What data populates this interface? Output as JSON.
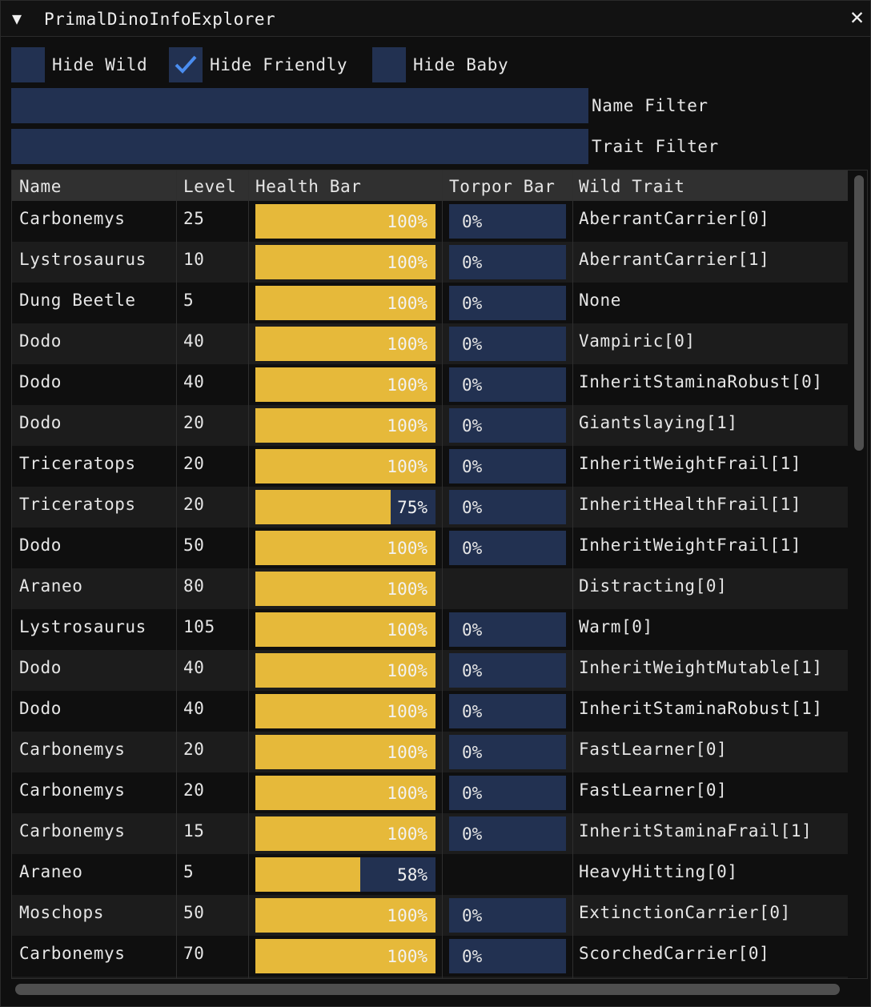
{
  "window": {
    "title": "PrimalDinoInfoExplorer",
    "collapse_glyph": "▼",
    "close_glyph": "✕"
  },
  "checkboxes": [
    {
      "label": "Hide Wild",
      "checked": false
    },
    {
      "label": "Hide Friendly",
      "checked": true
    },
    {
      "label": "Hide Baby",
      "checked": false
    }
  ],
  "filters": {
    "name_label": "Name Filter",
    "name_value": "",
    "trait_label": "Trait Filter",
    "trait_value": ""
  },
  "table": {
    "columns": [
      "Name",
      "Level",
      "Health Bar",
      "Torpor Bar",
      "Wild Trait"
    ],
    "rows": [
      {
        "name": "Carbonemys",
        "level": "25",
        "health": "100%",
        "health_frac": 1.0,
        "torpor": "0%",
        "trait": "AberrantCarrier[0]"
      },
      {
        "name": "Lystrosaurus",
        "level": "10",
        "health": "100%",
        "health_frac": 1.0,
        "torpor": "0%",
        "trait": "AberrantCarrier[1]"
      },
      {
        "name": "Dung Beetle",
        "level": "5",
        "health": "100%",
        "health_frac": 1.0,
        "torpor": "0%",
        "trait": "None"
      },
      {
        "name": "Dodo",
        "level": "40",
        "health": "100%",
        "health_frac": 1.0,
        "torpor": "0%",
        "trait": "Vampiric[0]"
      },
      {
        "name": "Dodo",
        "level": "40",
        "health": "100%",
        "health_frac": 1.0,
        "torpor": "0%",
        "trait": "InheritStaminaRobust[0]"
      },
      {
        "name": "Dodo",
        "level": "20",
        "health": "100%",
        "health_frac": 1.0,
        "torpor": "0%",
        "trait": "Giantslaying[1]"
      },
      {
        "name": "Triceratops",
        "level": "20",
        "health": "100%",
        "health_frac": 1.0,
        "torpor": "0%",
        "trait": "InheritWeightFrail[1]"
      },
      {
        "name": "Triceratops",
        "level": "20",
        "health": "75%",
        "health_frac": 0.75,
        "torpor": "0%",
        "trait": "InheritHealthFrail[1]"
      },
      {
        "name": "Dodo",
        "level": "50",
        "health": "100%",
        "health_frac": 1.0,
        "torpor": "0%",
        "trait": "InheritWeightFrail[1]"
      },
      {
        "name": "Araneo",
        "level": "80",
        "health": "100%",
        "health_frac": 1.0,
        "torpor": null,
        "trait": "Distracting[0]"
      },
      {
        "name": "Lystrosaurus",
        "level": "105",
        "health": "100%",
        "health_frac": 1.0,
        "torpor": "0%",
        "trait": "Warm[0]"
      },
      {
        "name": "Dodo",
        "level": "40",
        "health": "100%",
        "health_frac": 1.0,
        "torpor": "0%",
        "trait": "InheritWeightMutable[1]"
      },
      {
        "name": "Dodo",
        "level": "40",
        "health": "100%",
        "health_frac": 1.0,
        "torpor": "0%",
        "trait": "InheritStaminaRobust[1]"
      },
      {
        "name": "Carbonemys",
        "level": "20",
        "health": "100%",
        "health_frac": 1.0,
        "torpor": "0%",
        "trait": "FastLearner[0]"
      },
      {
        "name": "Carbonemys",
        "level": "20",
        "health": "100%",
        "health_frac": 1.0,
        "torpor": "0%",
        "trait": "FastLearner[0]"
      },
      {
        "name": "Carbonemys",
        "level": "15",
        "health": "100%",
        "health_frac": 1.0,
        "torpor": "0%",
        "trait": "InheritStaminaFrail[1]"
      },
      {
        "name": "Araneo",
        "level": "5",
        "health": "58%",
        "health_frac": 0.58,
        "torpor": null,
        "trait": "HeavyHitting[0]"
      },
      {
        "name": "Moschops",
        "level": "50",
        "health": "100%",
        "health_frac": 1.0,
        "torpor": "0%",
        "trait": "ExtinctionCarrier[0]"
      },
      {
        "name": "Carbonemys",
        "level": "70",
        "health": "100%",
        "health_frac": 1.0,
        "torpor": "0%",
        "trait": "ScorchedCarrier[0]"
      }
    ]
  },
  "colors": {
    "health_fill": "#e6b93a",
    "bar_bg": "#223151",
    "checkmark": "#4a8df0"
  }
}
